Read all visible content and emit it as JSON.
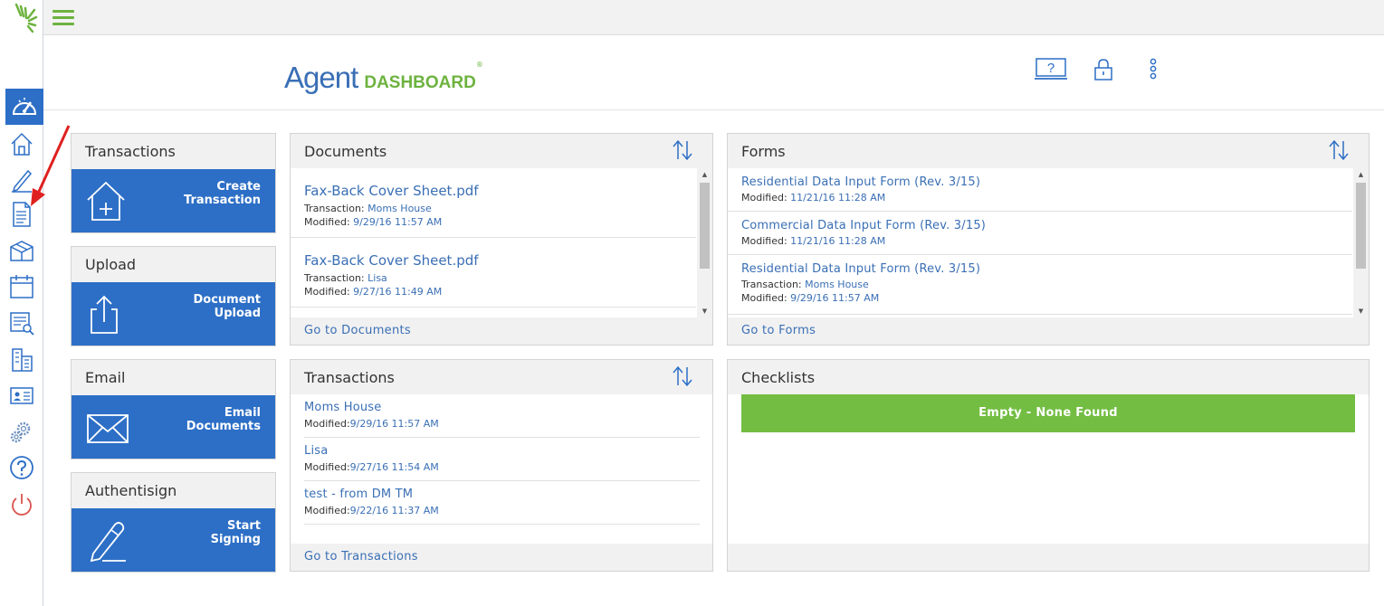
{
  "brand": {
    "agent": "Agent",
    "dashboard": "DASHBOARD",
    "reg": "®"
  },
  "colors": {
    "primary": "#2d6fc6",
    "accent": "#6db33f",
    "link": "#3a6fb5",
    "empty": "#73bd43"
  },
  "rail": {
    "items": [
      "dashboard-icon",
      "home-icon",
      "pen-icon",
      "document-icon",
      "packages-icon",
      "calendar-icon",
      "search-list-icon",
      "office-icon",
      "contact-card-icon",
      "settings-icon",
      "help-icon",
      "power-icon"
    ]
  },
  "header": {
    "icons": [
      "help-monitor-icon",
      "lock-icon",
      "more-vertical-icon"
    ],
    "help_mark": "?"
  },
  "tiles": [
    {
      "title": "Transactions",
      "line1": "Create",
      "line2": "Transaction"
    },
    {
      "title": "Upload",
      "line1": "Document",
      "line2": "Upload"
    },
    {
      "title": "Email",
      "line1": "Email",
      "line2": "Documents"
    },
    {
      "title": "Authentisign",
      "line1": "Start",
      "line2": "Signing"
    }
  ],
  "documents": {
    "title": "Documents",
    "footer": "Go to Documents",
    "items": [
      {
        "name": "Fax-Back Cover Sheet.pdf",
        "tx_label": "Transaction: ",
        "tx": "Moms House",
        "mod_label": "Modified: ",
        "modified": "9/29/16 11:57 AM"
      },
      {
        "name": "Fax-Back Cover Sheet.pdf",
        "tx_label": "Transaction: ",
        "tx": "Lisa",
        "mod_label": "Modified: ",
        "modified": "9/27/16 11:49 AM"
      }
    ]
  },
  "forms": {
    "title": "Forms",
    "footer": "Go to Forms",
    "items": [
      {
        "name": "Residential Data Input Form (Rev. 3/15)",
        "mod_label": "Modified: ",
        "modified": "11/21/16 11:28 AM"
      },
      {
        "name": "Commercial Data Input Form (Rev. 3/15)",
        "mod_label": "Modified: ",
        "modified": "11/21/16 11:28 AM"
      },
      {
        "name": "Residential Data Input Form (Rev. 3/15)",
        "tx_label": "Transaction: ",
        "tx": "Moms House",
        "mod_label": "Modified: ",
        "modified": "9/29/16 11:57 AM"
      }
    ]
  },
  "transactions": {
    "title": "Transactions",
    "footer": "Go to Transactions",
    "items": [
      {
        "name": "Moms House",
        "mod_label": "Modified:",
        "modified": "9/29/16 11:57 AM"
      },
      {
        "name": "Lisa",
        "mod_label": "Modified:",
        "modified": "9/27/16 11:54 AM"
      },
      {
        "name": "test - from DM TM",
        "mod_label": "Modified:",
        "modified": "9/22/16 11:37 AM"
      }
    ]
  },
  "checklists": {
    "title": "Checklists",
    "empty": "Empty - None Found"
  },
  "scroll": {
    "up": "▲",
    "down": "▼"
  }
}
